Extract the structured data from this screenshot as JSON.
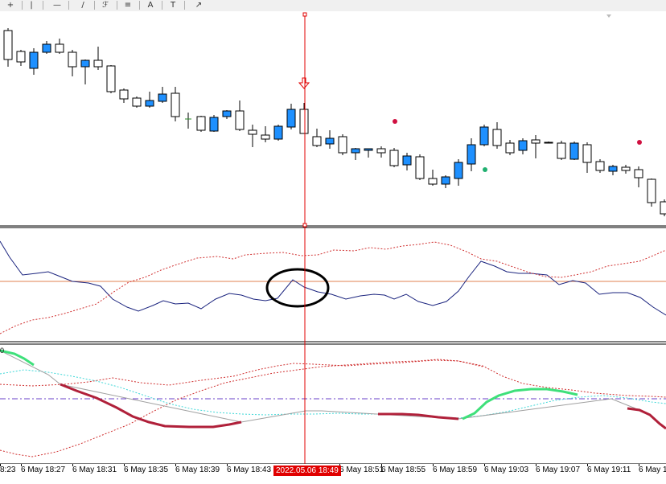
{
  "toolbar": {
    "tools": [
      {
        "name": "crosshair-icon",
        "glyph": "+"
      },
      {
        "name": "vertical-line-icon",
        "glyph": "|"
      },
      {
        "name": "horizontal-line-icon",
        "glyph": "—"
      },
      {
        "name": "trendline-icon",
        "glyph": "/"
      },
      {
        "name": "fibonacci-icon",
        "glyph": "ℱ"
      },
      {
        "name": "channel-icon",
        "glyph": "≡"
      },
      {
        "name": "text-tool-icon",
        "glyph": "A"
      },
      {
        "name": "label-tool-icon",
        "glyph": "T"
      },
      {
        "name": "arrow-tool-icon",
        "glyph": "↗"
      }
    ]
  },
  "colors": {
    "bull": "#1e90ff",
    "bear": "#ffffff",
    "candle_outline": "#000000",
    "cursor": "#e00000",
    "band": "#d03030",
    "osc_line": "#1a237e",
    "level_line": "#e08050",
    "lower_down": "#b0203a",
    "lower_up": "#3ee07a",
    "signal": "#40d8d8",
    "zero_line": "#6a40c8",
    "dot_red": "#d01040",
    "dot_green": "#20b070"
  },
  "time_axis": {
    "labels": [
      "8:23",
      "6 May 18:27",
      "6 May 18:31",
      "6 May 18:35",
      "6 May 18:39",
      "6 May 18:43",
      "6 May 18:51",
      "6 May 18:55",
      "6 May 18:59",
      "6 May 19:03",
      "6 May 19:07",
      "6 May 19:11",
      "6 May 1"
    ],
    "cursor_label": "2022.05.06 18:49"
  },
  "lower_panel": {
    "level_label": "0"
  }
}
